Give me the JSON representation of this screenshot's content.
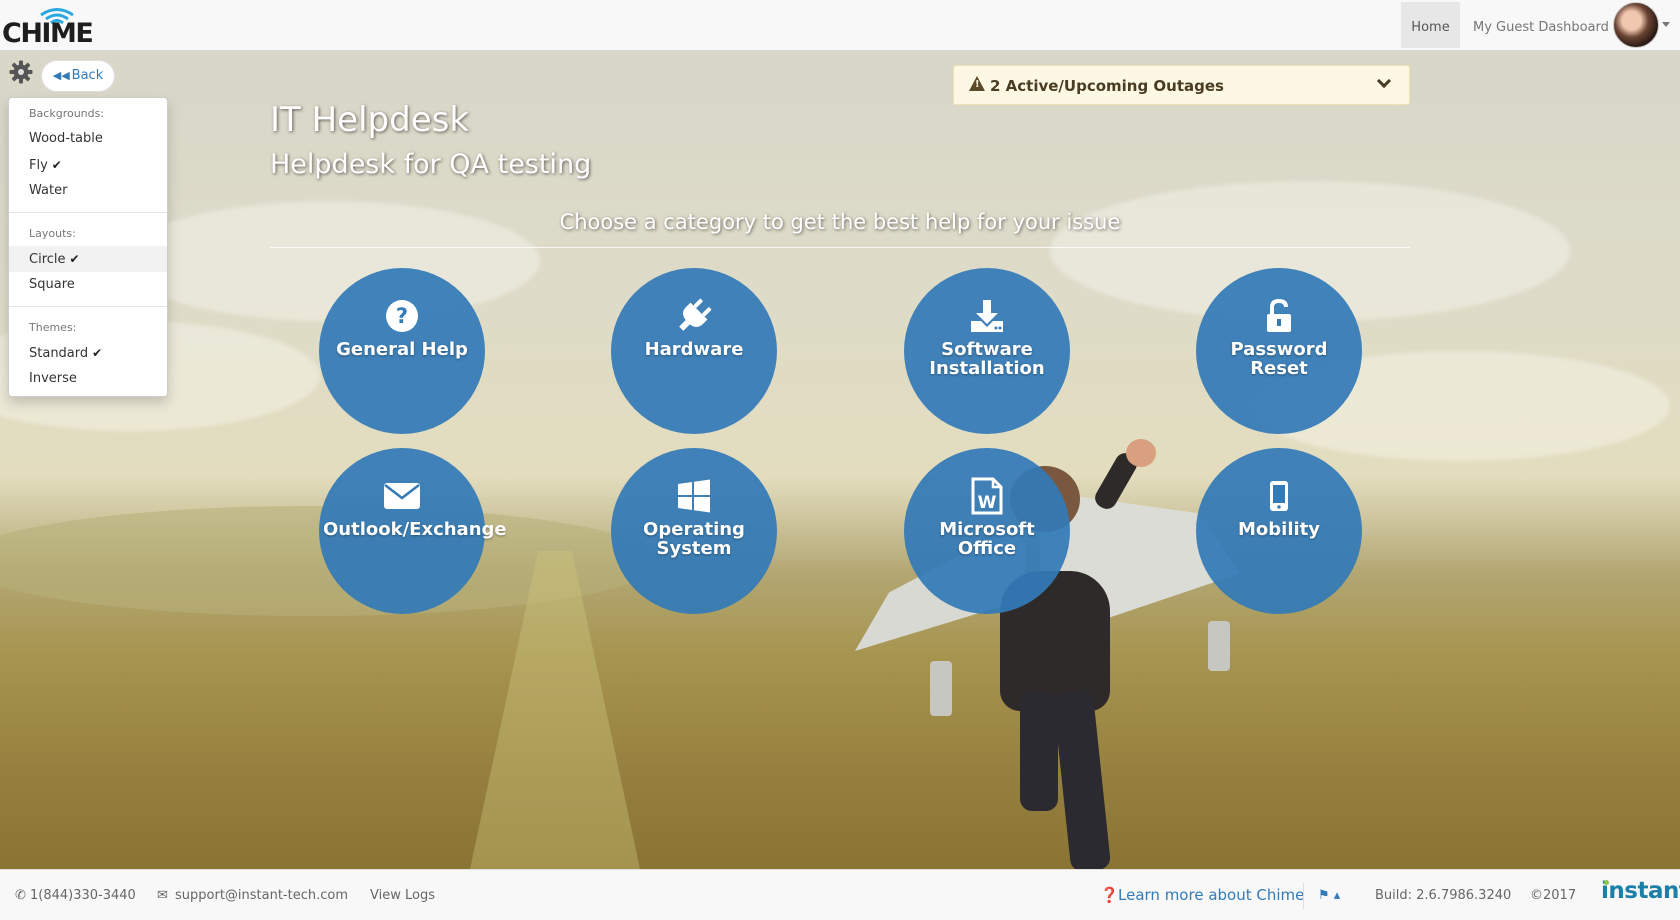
{
  "navbar": {
    "logo_text": "CHIME",
    "home_label": "Home",
    "guest_dashboard_label": "My Guest Dashboard"
  },
  "settings": {
    "back_label": "Back",
    "backgrounds_header": "Backgrounds:",
    "backgrounds": [
      "Wood-table",
      "Fly",
      "Water"
    ],
    "layouts_header": "Layouts:",
    "layouts": [
      "Circle",
      "Square"
    ],
    "themes_header": "Themes:",
    "themes": [
      "Standard",
      "Inverse"
    ],
    "checkmark": "✔"
  },
  "outage": {
    "text": "2 Active/Upcoming Outages"
  },
  "header": {
    "title": "IT Helpdesk",
    "subtitle": "Helpdesk for QA testing",
    "prompt": "Choose a category to get the best help for your issue"
  },
  "categories": [
    {
      "label": "General Help",
      "icon": "question-circle-icon"
    },
    {
      "label": "Hardware",
      "icon": "plug-icon"
    },
    {
      "label": "Software Installation",
      "icon": "download-icon"
    },
    {
      "label": "Password Reset",
      "icon": "unlock-icon"
    },
    {
      "label": "Outlook/Exchange",
      "icon": "envelope-icon"
    },
    {
      "label": "Operating System",
      "icon": "windows-icon"
    },
    {
      "label": "Microsoft Office",
      "icon": "word-file-icon"
    },
    {
      "label": "Mobility",
      "icon": "mobile-phone-icon"
    }
  ],
  "footer": {
    "phone": "1(844)330-3440",
    "email": "support@instant-tech.com",
    "view_logs": "View Logs",
    "learn_more": "Learn more about Chime",
    "build": "Build: 2.6.7986.3240",
    "copyright": "©2017",
    "brand": "instant"
  },
  "colors": {
    "tile": "#337ab7",
    "link": "#337ab7",
    "outage_bg": "#fcf8e3"
  }
}
